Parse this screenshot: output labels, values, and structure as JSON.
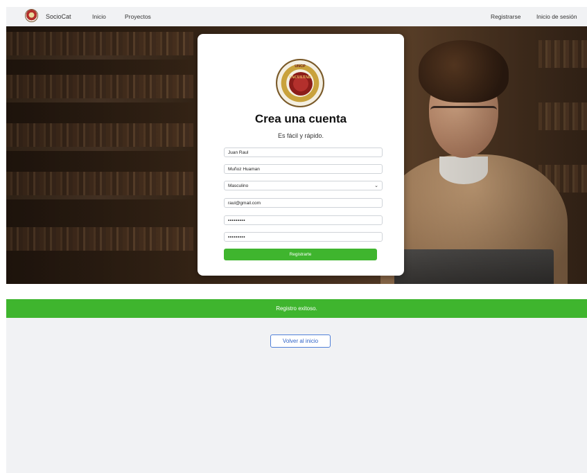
{
  "navbar": {
    "brand": "SocioCat",
    "links": [
      "Inicio",
      "Proyectos"
    ],
    "right_links": [
      "Registrarse",
      "Inicio de sesión"
    ]
  },
  "card": {
    "logo_text_top": "UNCP",
    "logo_text_mid": "FACULTAD",
    "title": "Crea una cuenta",
    "subtitle": "Es fácil y rápido.",
    "fields": {
      "first_name": "Juan Raul",
      "last_name": "Muñoz Huaman",
      "gender": "Masculino",
      "email": "raul@gmail.com",
      "password": "•••••••••",
      "confirm_password": "•••••••••"
    },
    "submit_label": "Registrarte"
  },
  "success_message": "Registro exitoso.",
  "back_button_label": "Volver al inicio",
  "colors": {
    "accent_green": "#3fb52e",
    "link_blue": "#2e62c7",
    "nav_bg": "#f1f2f4"
  }
}
